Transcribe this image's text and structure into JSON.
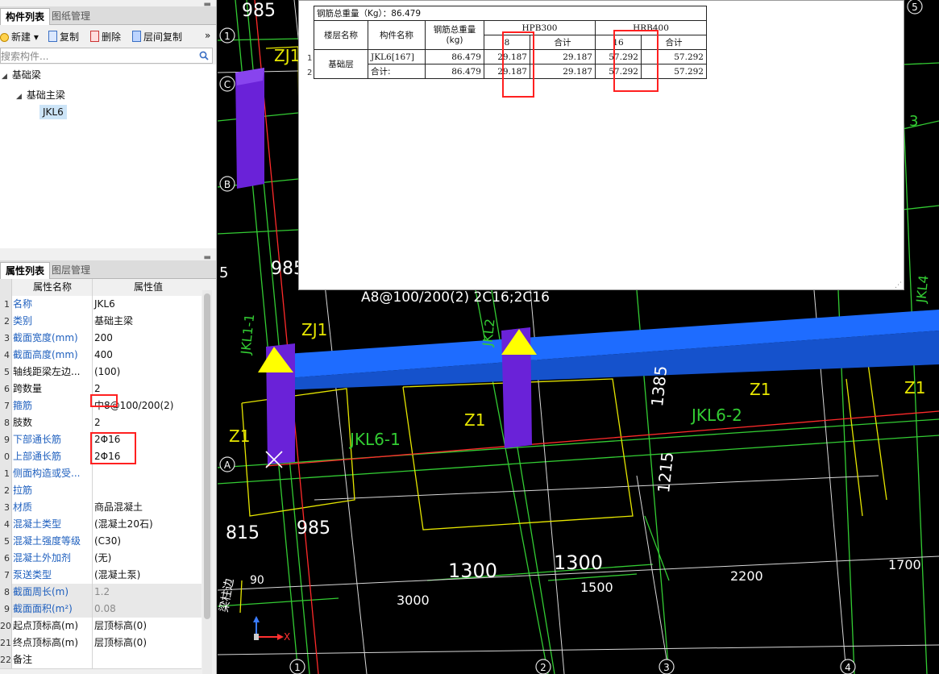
{
  "component_panel": {
    "tabs": [
      "构件列表",
      "图纸管理"
    ],
    "toolbar": {
      "new": "新建",
      "copy": "复制",
      "delete": "删除",
      "floor_copy": "层间复制",
      "more": "»"
    },
    "search_placeholder": "搜索构件...",
    "tree": {
      "root": "基础梁",
      "child": "基础主梁",
      "leaf": "JKL6"
    }
  },
  "property_panel": {
    "tabs": [
      "属性列表",
      "图层管理"
    ],
    "header": {
      "num": "",
      "name": "属性名称",
      "value": "属性值"
    },
    "rows": [
      {
        "num": "1",
        "name": "名称",
        "value": "JKL6"
      },
      {
        "num": "2",
        "name": "类别",
        "value": "基础主梁"
      },
      {
        "num": "3",
        "name": "截面宽度(mm)",
        "value": "200"
      },
      {
        "num": "4",
        "name": "截面高度(mm)",
        "value": "400"
      },
      {
        "num": "5",
        "name": "轴线距梁左边...",
        "value": "(100)"
      },
      {
        "num": "6",
        "name": "跨数量",
        "value": "2"
      },
      {
        "num": "7",
        "name": "箍筋",
        "value": "中8@100/200(2)"
      },
      {
        "num": "8",
        "name": "肢数",
        "value": "2"
      },
      {
        "num": "9",
        "name": "下部通长筋",
        "value": "2Φ16"
      },
      {
        "num": "0",
        "name": "上部通长筋",
        "value": "2Φ16"
      },
      {
        "num": "1",
        "name": "侧面构造或受...",
        "value": ""
      },
      {
        "num": "2",
        "name": "拉筋",
        "value": ""
      },
      {
        "num": "3",
        "name": "材质",
        "value": "商品混凝土"
      },
      {
        "num": "4",
        "name": "混凝土类型",
        "value": "(混凝土20石)"
      },
      {
        "num": "5",
        "name": "混凝土强度等级",
        "value": "(C30)"
      },
      {
        "num": "6",
        "name": "混凝土外加剂",
        "value": "(无)"
      },
      {
        "num": "7",
        "name": "泵送类型",
        "value": "(混凝土泵)"
      },
      {
        "num": "8",
        "name": "截面周长(m)",
        "value": "1.2"
      },
      {
        "num": "9",
        "name": "截面面积(m²)",
        "value": "0.08"
      },
      {
        "num": "20",
        "name": "起点顶标高(m)",
        "value": "层顶标高(0)"
      },
      {
        "num": "21",
        "name": "终点顶标高(m)",
        "value": "层顶标高(0)"
      },
      {
        "num": "22",
        "name": "备注",
        "value": ""
      }
    ]
  },
  "report": {
    "total_title": "钢筋总重量（Kg）：86.479",
    "headers": {
      "floor": "楼层名称",
      "component": "构件名称",
      "total_weight": "钢筋总重量\n(kg)",
      "grade1": "HPB300",
      "grade2": "HRB400",
      "dia1": "8",
      "sub1": "合计",
      "dia2": "16",
      "sub2": "合计"
    },
    "floor_name": "基础层",
    "rows": [
      {
        "no": "1",
        "component": "JKL6[167]",
        "total": "86.479",
        "d8": "29.187",
        "hpb_sum": "29.187",
        "d16": "57.292",
        "hrb_sum": "57.292"
      },
      {
        "no": "2",
        "component": "合计:",
        "total": "86.479",
        "d8": "29.187",
        "hpb_sum": "29.187",
        "d16": "57.292",
        "hrb_sum": "57.292"
      }
    ]
  },
  "cad_labels": {
    "dims": [
      "985",
      "985",
      "815",
      "985",
      "1300",
      "1300",
      "1500",
      "3000",
      "2200",
      "1700",
      "1385",
      "1215",
      "90"
    ],
    "beams": [
      "JKL6-1",
      "JKL6-2",
      "JKL1-1",
      "JKL2",
      "JKL4"
    ],
    "columns": [
      "Z1",
      "Z1",
      "Z1",
      "Z1",
      "ZJ1",
      "ZJ1"
    ],
    "axes": [
      "A",
      "B",
      "C",
      "1",
      "1",
      "2",
      "3",
      "4",
      "5",
      "5",
      "3"
    ],
    "annotation": "A8@100/200(2) 2C16;2C16",
    "corner_note": "梁柱边",
    "ucs_x": "X"
  },
  "colors": {
    "beam": "#1e6cff",
    "column": "#6a22d8",
    "marker": "#ffff00",
    "axis": "#33cc33",
    "outline": "#e6e600"
  }
}
